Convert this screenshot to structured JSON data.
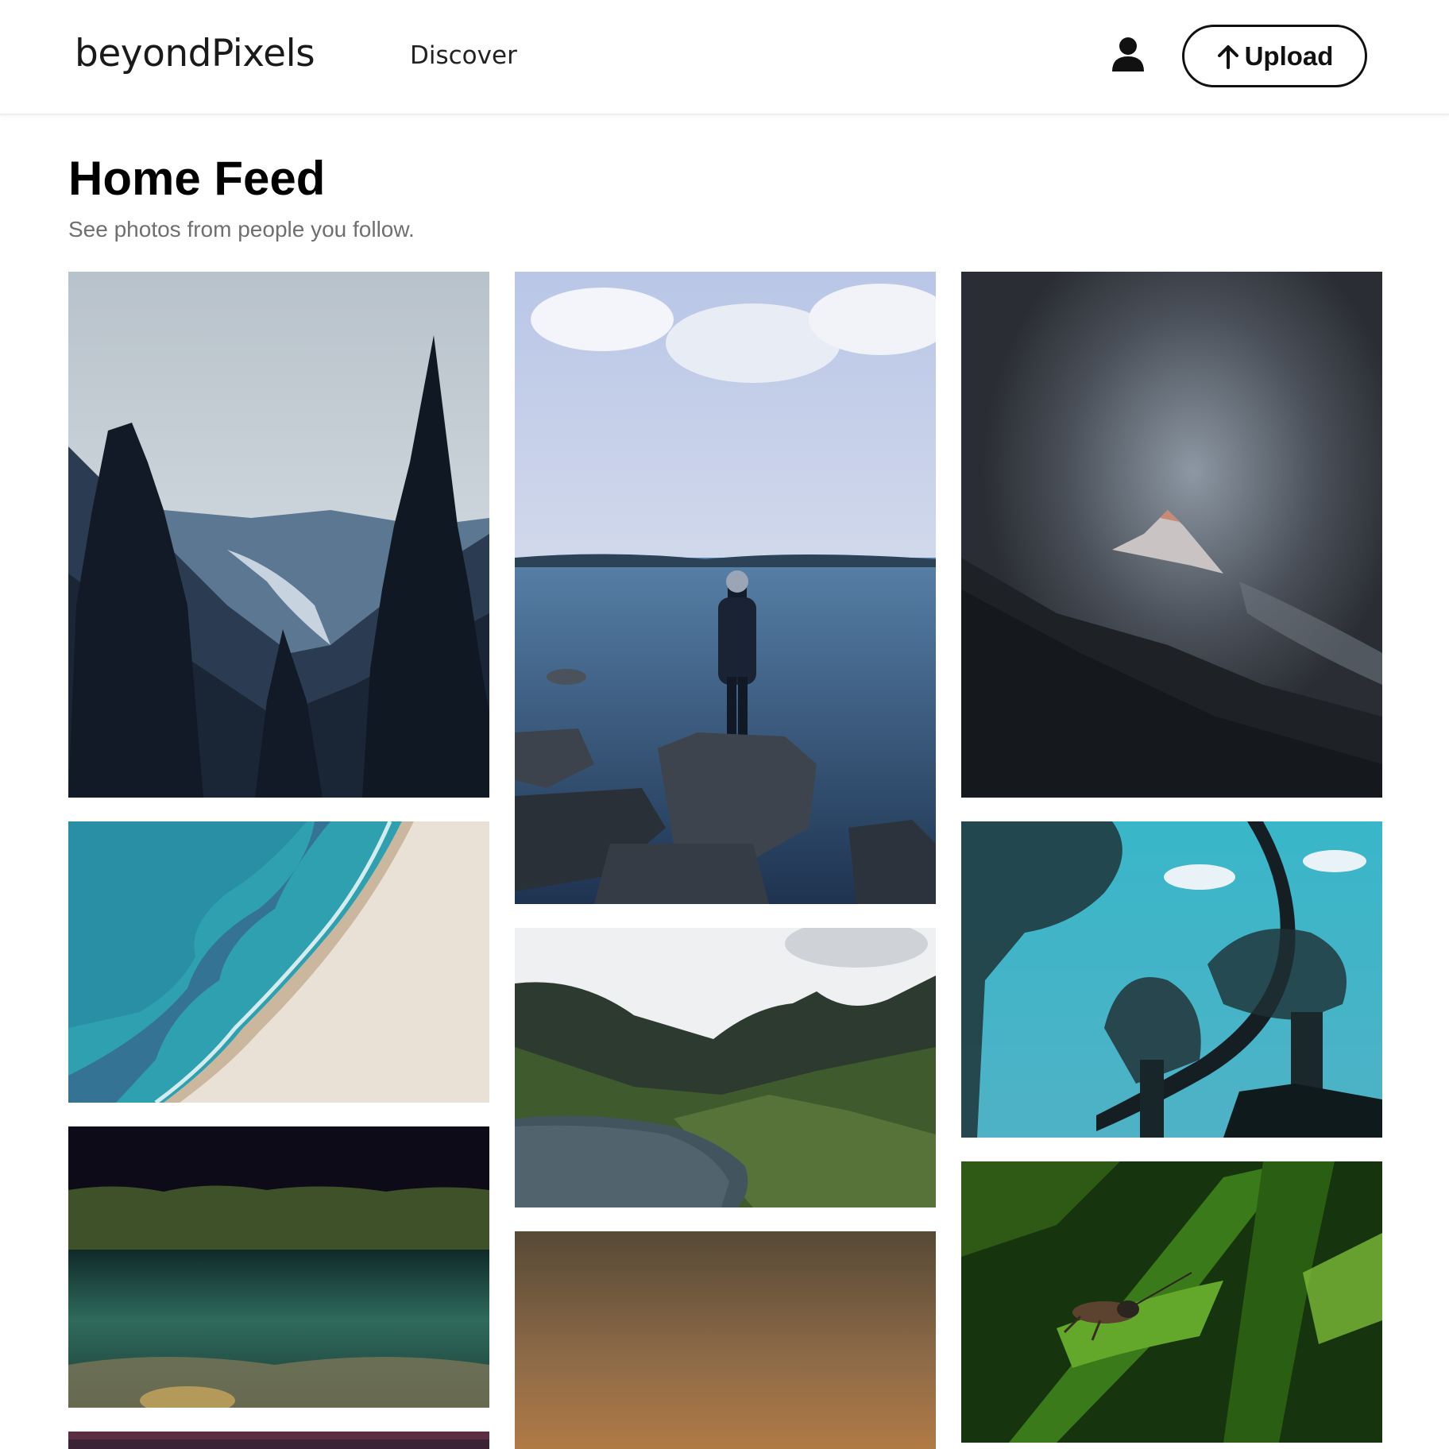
{
  "header": {
    "brand": "beyondPixels",
    "nav_discover": "Discover",
    "user_icon": "user-icon",
    "upload_icon": "arrow-up-icon",
    "upload_label": "Upload"
  },
  "feed": {
    "title": "Home Feed",
    "subtitle": "See photos from people you follow."
  },
  "colors": {
    "accent": "#111111",
    "subtitle": "#6f6f6f",
    "background": "#ffffff"
  }
}
